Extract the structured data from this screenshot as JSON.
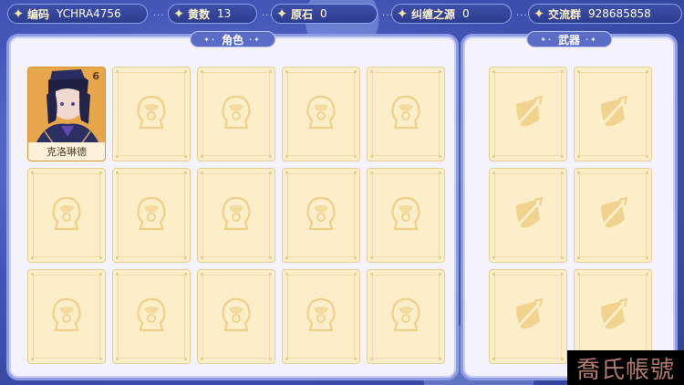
{
  "topbar": {
    "items": [
      {
        "label": "编码",
        "value": "YCHRA4756"
      },
      {
        "label": "黄数",
        "value": "13"
      },
      {
        "label": "原石",
        "value": "0"
      },
      {
        "label": "纠缠之源",
        "value": "0"
      },
      {
        "label": "交流群",
        "value": "928685858"
      }
    ],
    "separator": "···"
  },
  "characters_panel": {
    "title": "角色",
    "owned": [
      {
        "name": "克洛琳德",
        "constellation": "6"
      }
    ],
    "empty_slot_icon": "character-silhouette-icon"
  },
  "weapons_panel": {
    "title": "武器",
    "empty_slot_icon": "sword-shield-icon"
  },
  "colors": {
    "card_bg": "#fbeec9",
    "card_icon": "#f0d38f",
    "accent": "#f4e3a6",
    "panel_border": "#8d9be0"
  },
  "watermark": "喬氏帳號"
}
